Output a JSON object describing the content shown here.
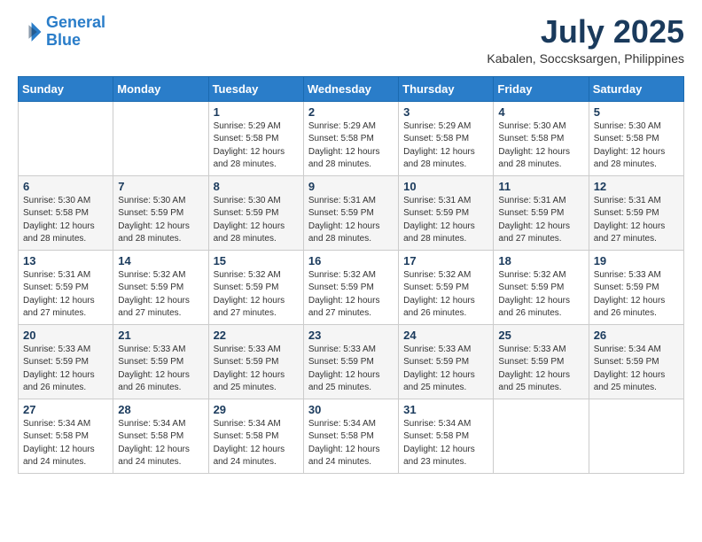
{
  "logo": {
    "line1": "General",
    "line2": "Blue"
  },
  "header": {
    "month": "July 2025",
    "location": "Kabalen, Soccsksargen, Philippines"
  },
  "weekdays": [
    "Sunday",
    "Monday",
    "Tuesday",
    "Wednesday",
    "Thursday",
    "Friday",
    "Saturday"
  ],
  "weeks": [
    [
      {
        "day": "",
        "sunrise": "",
        "sunset": "",
        "daylight": ""
      },
      {
        "day": "",
        "sunrise": "",
        "sunset": "",
        "daylight": ""
      },
      {
        "day": "1",
        "sunrise": "Sunrise: 5:29 AM",
        "sunset": "Sunset: 5:58 PM",
        "daylight": "Daylight: 12 hours and 28 minutes."
      },
      {
        "day": "2",
        "sunrise": "Sunrise: 5:29 AM",
        "sunset": "Sunset: 5:58 PM",
        "daylight": "Daylight: 12 hours and 28 minutes."
      },
      {
        "day": "3",
        "sunrise": "Sunrise: 5:29 AM",
        "sunset": "Sunset: 5:58 PM",
        "daylight": "Daylight: 12 hours and 28 minutes."
      },
      {
        "day": "4",
        "sunrise": "Sunrise: 5:30 AM",
        "sunset": "Sunset: 5:58 PM",
        "daylight": "Daylight: 12 hours and 28 minutes."
      },
      {
        "day": "5",
        "sunrise": "Sunrise: 5:30 AM",
        "sunset": "Sunset: 5:58 PM",
        "daylight": "Daylight: 12 hours and 28 minutes."
      }
    ],
    [
      {
        "day": "6",
        "sunrise": "Sunrise: 5:30 AM",
        "sunset": "Sunset: 5:58 PM",
        "daylight": "Daylight: 12 hours and 28 minutes."
      },
      {
        "day": "7",
        "sunrise": "Sunrise: 5:30 AM",
        "sunset": "Sunset: 5:59 PM",
        "daylight": "Daylight: 12 hours and 28 minutes."
      },
      {
        "day": "8",
        "sunrise": "Sunrise: 5:30 AM",
        "sunset": "Sunset: 5:59 PM",
        "daylight": "Daylight: 12 hours and 28 minutes."
      },
      {
        "day": "9",
        "sunrise": "Sunrise: 5:31 AM",
        "sunset": "Sunset: 5:59 PM",
        "daylight": "Daylight: 12 hours and 28 minutes."
      },
      {
        "day": "10",
        "sunrise": "Sunrise: 5:31 AM",
        "sunset": "Sunset: 5:59 PM",
        "daylight": "Daylight: 12 hours and 28 minutes."
      },
      {
        "day": "11",
        "sunrise": "Sunrise: 5:31 AM",
        "sunset": "Sunset: 5:59 PM",
        "daylight": "Daylight: 12 hours and 27 minutes."
      },
      {
        "day": "12",
        "sunrise": "Sunrise: 5:31 AM",
        "sunset": "Sunset: 5:59 PM",
        "daylight": "Daylight: 12 hours and 27 minutes."
      }
    ],
    [
      {
        "day": "13",
        "sunrise": "Sunrise: 5:31 AM",
        "sunset": "Sunset: 5:59 PM",
        "daylight": "Daylight: 12 hours and 27 minutes."
      },
      {
        "day": "14",
        "sunrise": "Sunrise: 5:32 AM",
        "sunset": "Sunset: 5:59 PM",
        "daylight": "Daylight: 12 hours and 27 minutes."
      },
      {
        "day": "15",
        "sunrise": "Sunrise: 5:32 AM",
        "sunset": "Sunset: 5:59 PM",
        "daylight": "Daylight: 12 hours and 27 minutes."
      },
      {
        "day": "16",
        "sunrise": "Sunrise: 5:32 AM",
        "sunset": "Sunset: 5:59 PM",
        "daylight": "Daylight: 12 hours and 27 minutes."
      },
      {
        "day": "17",
        "sunrise": "Sunrise: 5:32 AM",
        "sunset": "Sunset: 5:59 PM",
        "daylight": "Daylight: 12 hours and 26 minutes."
      },
      {
        "day": "18",
        "sunrise": "Sunrise: 5:32 AM",
        "sunset": "Sunset: 5:59 PM",
        "daylight": "Daylight: 12 hours and 26 minutes."
      },
      {
        "day": "19",
        "sunrise": "Sunrise: 5:33 AM",
        "sunset": "Sunset: 5:59 PM",
        "daylight": "Daylight: 12 hours and 26 minutes."
      }
    ],
    [
      {
        "day": "20",
        "sunrise": "Sunrise: 5:33 AM",
        "sunset": "Sunset: 5:59 PM",
        "daylight": "Daylight: 12 hours and 26 minutes."
      },
      {
        "day": "21",
        "sunrise": "Sunrise: 5:33 AM",
        "sunset": "Sunset: 5:59 PM",
        "daylight": "Daylight: 12 hours and 26 minutes."
      },
      {
        "day": "22",
        "sunrise": "Sunrise: 5:33 AM",
        "sunset": "Sunset: 5:59 PM",
        "daylight": "Daylight: 12 hours and 25 minutes."
      },
      {
        "day": "23",
        "sunrise": "Sunrise: 5:33 AM",
        "sunset": "Sunset: 5:59 PM",
        "daylight": "Daylight: 12 hours and 25 minutes."
      },
      {
        "day": "24",
        "sunrise": "Sunrise: 5:33 AM",
        "sunset": "Sunset: 5:59 PM",
        "daylight": "Daylight: 12 hours and 25 minutes."
      },
      {
        "day": "25",
        "sunrise": "Sunrise: 5:33 AM",
        "sunset": "Sunset: 5:59 PM",
        "daylight": "Daylight: 12 hours and 25 minutes."
      },
      {
        "day": "26",
        "sunrise": "Sunrise: 5:34 AM",
        "sunset": "Sunset: 5:59 PM",
        "daylight": "Daylight: 12 hours and 25 minutes."
      }
    ],
    [
      {
        "day": "27",
        "sunrise": "Sunrise: 5:34 AM",
        "sunset": "Sunset: 5:58 PM",
        "daylight": "Daylight: 12 hours and 24 minutes."
      },
      {
        "day": "28",
        "sunrise": "Sunrise: 5:34 AM",
        "sunset": "Sunset: 5:58 PM",
        "daylight": "Daylight: 12 hours and 24 minutes."
      },
      {
        "day": "29",
        "sunrise": "Sunrise: 5:34 AM",
        "sunset": "Sunset: 5:58 PM",
        "daylight": "Daylight: 12 hours and 24 minutes."
      },
      {
        "day": "30",
        "sunrise": "Sunrise: 5:34 AM",
        "sunset": "Sunset: 5:58 PM",
        "daylight": "Daylight: 12 hours and 24 minutes."
      },
      {
        "day": "31",
        "sunrise": "Sunrise: 5:34 AM",
        "sunset": "Sunset: 5:58 PM",
        "daylight": "Daylight: 12 hours and 23 minutes."
      },
      {
        "day": "",
        "sunrise": "",
        "sunset": "",
        "daylight": ""
      },
      {
        "day": "",
        "sunrise": "",
        "sunset": "",
        "daylight": ""
      }
    ]
  ]
}
